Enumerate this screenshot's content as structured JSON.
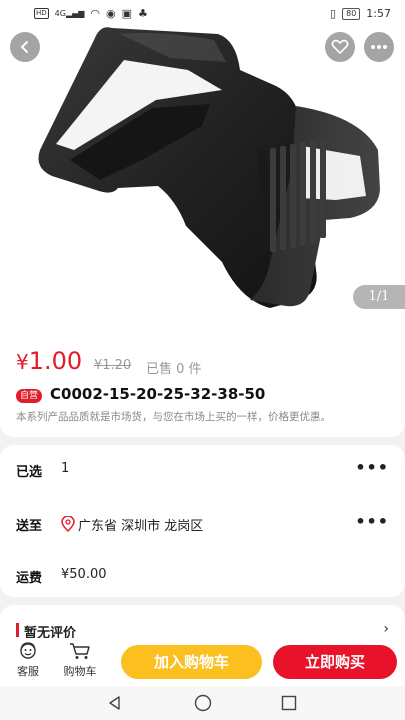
{
  "status_bar": {
    "network_badge": "HD",
    "signal": "4G",
    "battery": "80",
    "time": "1:57"
  },
  "hero": {
    "pager": "1/1"
  },
  "product": {
    "price_symbol": "¥",
    "price": "1.00",
    "original_price": "¥1.20",
    "sold": "已售 0 件",
    "tag": "自营",
    "title": "C0002-15-20-25-32-38-50",
    "description": "本系列产品品质就是市场货，与您在市场上买的一样，价格更优惠。"
  },
  "specs": {
    "selected_label": "已选",
    "selected_value": "1",
    "ship_to_label": "送至",
    "ship_to_value": "广东省 深圳市 龙岗区",
    "freight_label": "运费",
    "freight_value": "¥50.00"
  },
  "reviews": {
    "label": "暂无评价"
  },
  "action_bar": {
    "service_label": "客服",
    "cart_label": "购物车",
    "add_to_cart": "加入购物车",
    "buy_now": "立即购买"
  },
  "colors": {
    "accent_red": "#e21c2a",
    "cart_yellow": "#fbbf1f"
  }
}
